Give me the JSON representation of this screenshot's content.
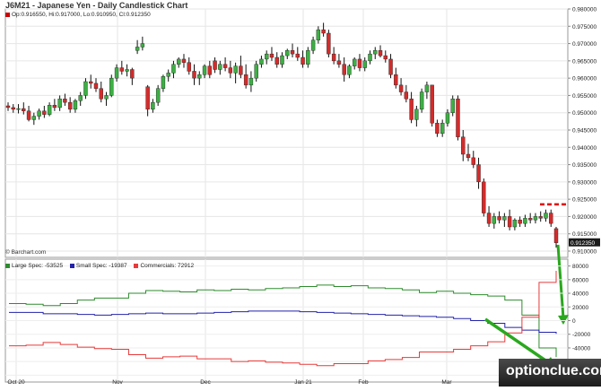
{
  "header": {
    "title": "J6M21 - Japanese Yen - Daily Candlestick Chart",
    "ohlc": "Op:0.916550, Hi:0.917000, Lo:0.910950, Cl:0.912350"
  },
  "credit": "© Barchart.com",
  "brand": "optionclue.com",
  "chart_data": [
    {
      "type": "candlestick",
      "title": "J6M21 - Japanese Yen - Daily Candlestick Chart",
      "ylim": [
        0.91,
        0.98
      ],
      "y_ticks": [
        "0.980000",
        "0.975000",
        "0.970000",
        "0.965000",
        "0.960000",
        "0.955000",
        "0.950000",
        "0.945000",
        "0.940000",
        "0.935000",
        "0.930000",
        "0.925000",
        "0.920000",
        "0.915000",
        "0.910000"
      ],
      "x_ticks": [
        "Oct 20",
        "Nov",
        "Dec",
        "Jan 21",
        "Feb",
        "Mar"
      ],
      "last_price_label": "0.912350",
      "resistance_level": 0.9235,
      "candles": [
        {
          "o": 0.952,
          "h": 0.953,
          "l": 0.9505,
          "c": 0.9515
        },
        {
          "o": 0.9515,
          "h": 0.9525,
          "l": 0.95,
          "c": 0.951
        },
        {
          "o": 0.951,
          "h": 0.9525,
          "l": 0.9498,
          "c": 0.9512
        },
        {
          "o": 0.9512,
          "h": 0.953,
          "l": 0.9495,
          "c": 0.9505
        },
        {
          "o": 0.9505,
          "h": 0.952,
          "l": 0.9475,
          "c": 0.948
        },
        {
          "o": 0.948,
          "h": 0.95,
          "l": 0.9465,
          "c": 0.949
        },
        {
          "o": 0.949,
          "h": 0.9512,
          "l": 0.948,
          "c": 0.9505
        },
        {
          "o": 0.9505,
          "h": 0.952,
          "l": 0.9485,
          "c": 0.9495
        },
        {
          "o": 0.9495,
          "h": 0.953,
          "l": 0.949,
          "c": 0.9522
        },
        {
          "o": 0.9522,
          "h": 0.954,
          "l": 0.9505,
          "c": 0.9515
        },
        {
          "o": 0.9515,
          "h": 0.955,
          "l": 0.9505,
          "c": 0.954
        },
        {
          "o": 0.954,
          "h": 0.9555,
          "l": 0.952,
          "c": 0.953
        },
        {
          "o": 0.953,
          "h": 0.9545,
          "l": 0.95,
          "c": 0.951
        },
        {
          "o": 0.951,
          "h": 0.954,
          "l": 0.95,
          "c": 0.9535
        },
        {
          "o": 0.9535,
          "h": 0.956,
          "l": 0.952,
          "c": 0.955
        },
        {
          "o": 0.955,
          "h": 0.96,
          "l": 0.954,
          "c": 0.959
        },
        {
          "o": 0.959,
          "h": 0.961,
          "l": 0.957,
          "c": 0.9585
        },
        {
          "o": 0.9585,
          "h": 0.96,
          "l": 0.956,
          "c": 0.957
        },
        {
          "o": 0.957,
          "h": 0.959,
          "l": 0.953,
          "c": 0.954
        },
        {
          "o": 0.954,
          "h": 0.956,
          "l": 0.952,
          "c": 0.955
        },
        {
          "o": 0.955,
          "h": 0.961,
          "l": 0.9545,
          "c": 0.96
        },
        {
          "o": 0.96,
          "h": 0.964,
          "l": 0.959,
          "c": 0.963
        },
        {
          "o": 0.963,
          "h": 0.965,
          "l": 0.961,
          "c": 0.962
        },
        {
          "o": 0.962,
          "h": 0.964,
          "l": 0.9605,
          "c": 0.9625
        },
        {
          "o": 0.9625,
          "h": 0.963,
          "l": 0.958,
          "c": 0.96
        },
        {
          "o": 0.968,
          "h": 0.971,
          "l": 0.967,
          "c": 0.969
        },
        {
          "o": 0.969,
          "h": 0.972,
          "l": 0.968,
          "c": 0.97
        },
        {
          "o": 0.9575,
          "h": 0.958,
          "l": 0.949,
          "c": 0.951
        },
        {
          "o": 0.951,
          "h": 0.954,
          "l": 0.95,
          "c": 0.953
        },
        {
          "o": 0.953,
          "h": 0.958,
          "l": 0.952,
          "c": 0.957
        },
        {
          "o": 0.957,
          "h": 0.961,
          "l": 0.956,
          "c": 0.9605
        },
        {
          "o": 0.9605,
          "h": 0.9625,
          "l": 0.959,
          "c": 0.9615
        },
        {
          "o": 0.9615,
          "h": 0.965,
          "l": 0.96,
          "c": 0.964
        },
        {
          "o": 0.964,
          "h": 0.966,
          "l": 0.963,
          "c": 0.9655
        },
        {
          "o": 0.9655,
          "h": 0.967,
          "l": 0.963,
          "c": 0.9645
        },
        {
          "o": 0.9645,
          "h": 0.966,
          "l": 0.961,
          "c": 0.962
        },
        {
          "o": 0.962,
          "h": 0.964,
          "l": 0.958,
          "c": 0.96
        },
        {
          "o": 0.96,
          "h": 0.962,
          "l": 0.958,
          "c": 0.961
        },
        {
          "o": 0.961,
          "h": 0.964,
          "l": 0.96,
          "c": 0.9635
        },
        {
          "o": 0.9635,
          "h": 0.965,
          "l": 0.96,
          "c": 0.961
        },
        {
          "o": 0.965,
          "h": 0.966,
          "l": 0.9615,
          "c": 0.9625
        },
        {
          "o": 0.9625,
          "h": 0.965,
          "l": 0.961,
          "c": 0.964
        },
        {
          "o": 0.964,
          "h": 0.966,
          "l": 0.962,
          "c": 0.963
        },
        {
          "o": 0.963,
          "h": 0.965,
          "l": 0.96,
          "c": 0.9615
        },
        {
          "o": 0.9615,
          "h": 0.9645,
          "l": 0.9585,
          "c": 0.9635
        },
        {
          "o": 0.9635,
          "h": 0.9665,
          "l": 0.96,
          "c": 0.961
        },
        {
          "o": 0.961,
          "h": 0.964,
          "l": 0.957,
          "c": 0.958
        },
        {
          "o": 0.958,
          "h": 0.962,
          "l": 0.956,
          "c": 0.96
        },
        {
          "o": 0.96,
          "h": 0.965,
          "l": 0.959,
          "c": 0.964
        },
        {
          "o": 0.964,
          "h": 0.9665,
          "l": 0.963,
          "c": 0.9655
        },
        {
          "o": 0.9655,
          "h": 0.968,
          "l": 0.964,
          "c": 0.967
        },
        {
          "o": 0.967,
          "h": 0.969,
          "l": 0.965,
          "c": 0.966
        },
        {
          "o": 0.966,
          "h": 0.9675,
          "l": 0.963,
          "c": 0.964
        },
        {
          "o": 0.964,
          "h": 0.9675,
          "l": 0.963,
          "c": 0.9665
        },
        {
          "o": 0.9665,
          "h": 0.9685,
          "l": 0.9655,
          "c": 0.968
        },
        {
          "o": 0.968,
          "h": 0.97,
          "l": 0.966,
          "c": 0.967
        },
        {
          "o": 0.967,
          "h": 0.969,
          "l": 0.965,
          "c": 0.966
        },
        {
          "o": 0.966,
          "h": 0.968,
          "l": 0.963,
          "c": 0.964
        },
        {
          "o": 0.964,
          "h": 0.969,
          "l": 0.963,
          "c": 0.968
        },
        {
          "o": 0.968,
          "h": 0.972,
          "l": 0.967,
          "c": 0.971
        },
        {
          "o": 0.971,
          "h": 0.975,
          "l": 0.97,
          "c": 0.974
        },
        {
          "o": 0.974,
          "h": 0.976,
          "l": 0.972,
          "c": 0.973
        },
        {
          "o": 0.973,
          "h": 0.974,
          "l": 0.966,
          "c": 0.967
        },
        {
          "o": 0.967,
          "h": 0.969,
          "l": 0.964,
          "c": 0.965
        },
        {
          "o": 0.965,
          "h": 0.967,
          "l": 0.963,
          "c": 0.964
        },
        {
          "o": 0.964,
          "h": 0.966,
          "l": 0.959,
          "c": 0.961
        },
        {
          "o": 0.961,
          "h": 0.964,
          "l": 0.96,
          "c": 0.9635
        },
        {
          "o": 0.9635,
          "h": 0.966,
          "l": 0.9625,
          "c": 0.9655
        },
        {
          "o": 0.9655,
          "h": 0.967,
          "l": 0.962,
          "c": 0.963
        },
        {
          "o": 0.963,
          "h": 0.966,
          "l": 0.962,
          "c": 0.965
        },
        {
          "o": 0.965,
          "h": 0.968,
          "l": 0.964,
          "c": 0.967
        },
        {
          "o": 0.967,
          "h": 0.969,
          "l": 0.9655,
          "c": 0.968
        },
        {
          "o": 0.968,
          "h": 0.9695,
          "l": 0.966,
          "c": 0.9665
        },
        {
          "o": 0.9665,
          "h": 0.968,
          "l": 0.9645,
          "c": 0.9655
        },
        {
          "o": 0.9655,
          "h": 0.967,
          "l": 0.96,
          "c": 0.961
        },
        {
          "o": 0.961,
          "h": 0.963,
          "l": 0.957,
          "c": 0.958
        },
        {
          "o": 0.958,
          "h": 0.96,
          "l": 0.955,
          "c": 0.956
        },
        {
          "o": 0.956,
          "h": 0.958,
          "l": 0.953,
          "c": 0.954
        },
        {
          "o": 0.954,
          "h": 0.956,
          "l": 0.947,
          "c": 0.948
        },
        {
          "o": 0.948,
          "h": 0.952,
          "l": 0.946,
          "c": 0.951
        },
        {
          "o": 0.951,
          "h": 0.957,
          "l": 0.95,
          "c": 0.956
        },
        {
          "o": 0.956,
          "h": 0.959,
          "l": 0.954,
          "c": 0.958
        },
        {
          "o": 0.958,
          "h": 0.958,
          "l": 0.946,
          "c": 0.947
        },
        {
          "o": 0.947,
          "h": 0.948,
          "l": 0.943,
          "c": 0.944
        },
        {
          "o": 0.944,
          "h": 0.948,
          "l": 0.943,
          "c": 0.947
        },
        {
          "o": 0.947,
          "h": 0.951,
          "l": 0.946,
          "c": 0.95
        },
        {
          "o": 0.95,
          "h": 0.955,
          "l": 0.949,
          "c": 0.954
        },
        {
          "o": 0.954,
          "h": 0.955,
          "l": 0.942,
          "c": 0.943
        },
        {
          "o": 0.943,
          "h": 0.945,
          "l": 0.936,
          "c": 0.938
        },
        {
          "o": 0.938,
          "h": 0.941,
          "l": 0.936,
          "c": 0.937
        },
        {
          "o": 0.937,
          "h": 0.939,
          "l": 0.934,
          "c": 0.935
        },
        {
          "o": 0.935,
          "h": 0.937,
          "l": 0.928,
          "c": 0.93
        },
        {
          "o": 0.93,
          "h": 0.931,
          "l": 0.92,
          "c": 0.921
        },
        {
          "o": 0.921,
          "h": 0.923,
          "l": 0.917,
          "c": 0.918
        },
        {
          "o": 0.918,
          "h": 0.921,
          "l": 0.9165,
          "c": 0.92
        },
        {
          "o": 0.92,
          "h": 0.9215,
          "l": 0.918,
          "c": 0.919
        },
        {
          "o": 0.919,
          "h": 0.921,
          "l": 0.917,
          "c": 0.92
        },
        {
          "o": 0.92,
          "h": 0.922,
          "l": 0.916,
          "c": 0.917
        },
        {
          "o": 0.917,
          "h": 0.9195,
          "l": 0.916,
          "c": 0.919
        },
        {
          "o": 0.919,
          "h": 0.92,
          "l": 0.917,
          "c": 0.918
        },
        {
          "o": 0.918,
          "h": 0.9205,
          "l": 0.917,
          "c": 0.9195
        },
        {
          "o": 0.9195,
          "h": 0.921,
          "l": 0.918,
          "c": 0.919
        },
        {
          "o": 0.919,
          "h": 0.921,
          "l": 0.918,
          "c": 0.92
        },
        {
          "o": 0.92,
          "h": 0.9215,
          "l": 0.9185,
          "c": 0.9195
        },
        {
          "o": 0.9195,
          "h": 0.922,
          "l": 0.9185,
          "c": 0.921
        },
        {
          "o": 0.921,
          "h": 0.922,
          "l": 0.917,
          "c": 0.918
        },
        {
          "o": 0.9165,
          "h": 0.917,
          "l": 0.911,
          "c": 0.9124
        }
      ]
    },
    {
      "type": "line",
      "title": "",
      "ylim": [
        -90000,
        90000
      ],
      "y_ticks": [
        "80000",
        "60000",
        "40000",
        "20000",
        "0",
        "-20000",
        "-40000",
        "-60000",
        "-80000"
      ],
      "x_ticks": [
        "Oct 20",
        "Nov",
        "Dec",
        "Jan 21",
        "Feb",
        "Mar"
      ],
      "series": [
        {
          "name": "Large Spec: -53525",
          "color": "#2e8b2e",
          "values": [
            25000,
            24000,
            22000,
            25000,
            30000,
            33000,
            33000,
            40000,
            44000,
            43000,
            42000,
            45000,
            44000,
            46000,
            45000,
            47000,
            48000,
            50000,
            52000,
            50000,
            51000,
            48000,
            47000,
            45000,
            41000,
            43000,
            40000,
            38000,
            36000,
            30000,
            8000,
            -40000,
            -53525
          ]
        },
        {
          "name": "Small Spec: -19387",
          "color": "#2222aa",
          "values": [
            12000,
            12000,
            10000,
            10000,
            9000,
            8000,
            9000,
            10000,
            11000,
            10000,
            10000,
            11000,
            12000,
            13000,
            14000,
            14000,
            14000,
            13000,
            12000,
            11000,
            10000,
            9000,
            8000,
            7000,
            6000,
            5000,
            3000,
            0,
            -4000,
            -10000,
            -14000,
            -17000,
            -19387
          ]
        },
        {
          "name": "Commercials: 72912",
          "color": "#e83a3a",
          "values": [
            -37000,
            -36000,
            -32000,
            -35000,
            -39000,
            -41000,
            -42000,
            -50000,
            -55000,
            -53000,
            -52000,
            -56000,
            -56000,
            -60000,
            -59000,
            -61000,
            -62000,
            -64000,
            -66000,
            -63000,
            -63000,
            -59000,
            -57000,
            -54000,
            -46000,
            -46000,
            -42000,
            -37000,
            -31000,
            -18000,
            5000,
            56000,
            72912
          ]
        }
      ]
    }
  ]
}
